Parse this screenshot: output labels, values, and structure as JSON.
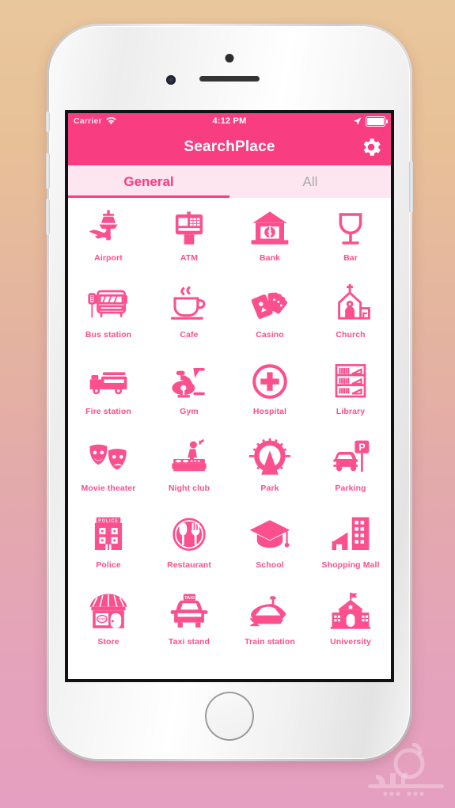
{
  "status_bar": {
    "carrier": "Carrier",
    "wifi_icon": "wifi-icon",
    "time": "4:12 PM",
    "location_icon": "location-arrow-icon",
    "battery_icon": "battery-full-icon"
  },
  "nav_bar": {
    "title": "SearchPlace",
    "settings_icon": "gear-icon"
  },
  "tabs": [
    {
      "label": "General",
      "active": true
    },
    {
      "label": "All",
      "active": false
    }
  ],
  "colors": {
    "brand_pink": "#f93d81",
    "icon_pink": "#fb4f8e",
    "tab_bar_bg": "#fde6ef",
    "inactive_tab": "#a9a9a9",
    "screen_bg": "#ffffff"
  },
  "grid": {
    "columns": 4,
    "items": [
      {
        "label": "Airport",
        "icon": "airport-icon"
      },
      {
        "label": "ATM",
        "icon": "atm-icon"
      },
      {
        "label": "Bank",
        "icon": "bank-icon"
      },
      {
        "label": "Bar",
        "icon": "bar-icon"
      },
      {
        "label": "Bus station",
        "icon": "bus-station-icon"
      },
      {
        "label": "Cafe",
        "icon": "cafe-icon"
      },
      {
        "label": "Casino",
        "icon": "casino-icon"
      },
      {
        "label": "Church",
        "icon": "church-icon"
      },
      {
        "label": "Fire station",
        "icon": "fire-station-icon"
      },
      {
        "label": "Gym",
        "icon": "gym-icon"
      },
      {
        "label": "Hospital",
        "icon": "hospital-icon"
      },
      {
        "label": "Library",
        "icon": "library-icon"
      },
      {
        "label": "Movie theater",
        "icon": "movie-theater-icon"
      },
      {
        "label": "Night club",
        "icon": "night-club-icon"
      },
      {
        "label": "Park",
        "icon": "park-icon"
      },
      {
        "label": "Parking",
        "icon": "parking-icon"
      },
      {
        "label": "Police",
        "icon": "police-icon"
      },
      {
        "label": "Restaurant",
        "icon": "restaurant-icon"
      },
      {
        "label": "School",
        "icon": "school-icon"
      },
      {
        "label": "Shopping Mall",
        "icon": "shopping-mall-icon"
      },
      {
        "label": "Store",
        "icon": "store-icon"
      },
      {
        "label": "Taxi stand",
        "icon": "taxi-stand-icon"
      },
      {
        "label": "Train station",
        "icon": "train-station-icon"
      },
      {
        "label": "University",
        "icon": "university-icon"
      }
    ]
  },
  "device": {
    "type": "white-iphone",
    "home_button": "home-button",
    "camera": "front-camera",
    "earpiece": "earpiece-speaker",
    "sensor": "proximity-sensor"
  },
  "watermark": {
    "text": "سماحة",
    "name": "arabic-site-watermark"
  }
}
